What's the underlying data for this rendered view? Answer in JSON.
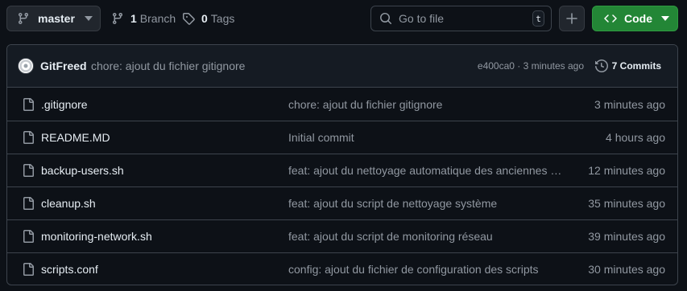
{
  "toolbar": {
    "branch_name": "master",
    "branches_count": "1",
    "branches_label": "Branch",
    "tags_count": "0",
    "tags_label": "Tags",
    "search_placeholder": "Go to file",
    "search_shortcut": "t",
    "add_label": "+",
    "code_label": "Code"
  },
  "commit": {
    "author": "GitFreed",
    "message": "chore: ajout du fichier gitignore",
    "meta": "e400ca0 · 3 minutes ago",
    "commits_label": "7 Commits"
  },
  "files": [
    {
      "name": ".gitignore",
      "message": "chore: ajout du fichier gitignore",
      "time": "3 minutes ago"
    },
    {
      "name": "README.MD",
      "message": "Initial commit",
      "time": "4 hours ago"
    },
    {
      "name": "backup-users.sh",
      "message": "feat: ajout du nettoyage automatique des anciennes sauvegardes",
      "time": "12 minutes ago"
    },
    {
      "name": "cleanup.sh",
      "message": "feat: ajout du script de nettoyage système",
      "time": "35 minutes ago"
    },
    {
      "name": "monitoring-network.sh",
      "message": "feat: ajout du script de monitoring réseau",
      "time": "39 minutes ago"
    },
    {
      "name": "scripts.conf",
      "message": "config: ajout du fichier de configuration des scripts",
      "time": "30 minutes ago"
    }
  ],
  "icons": {
    "branch": "git-branch-icon",
    "tag": "tag-icon",
    "search": "search-icon",
    "code": "code-icon",
    "history": "history-icon",
    "file": "file-icon",
    "caret": "triangle-down-icon"
  },
  "colors": {
    "background": "#0d1117",
    "panel_header": "#151b23",
    "border": "#3d444d",
    "text": "#e6edf3",
    "muted": "#9198a1",
    "code_button": "#238636"
  }
}
